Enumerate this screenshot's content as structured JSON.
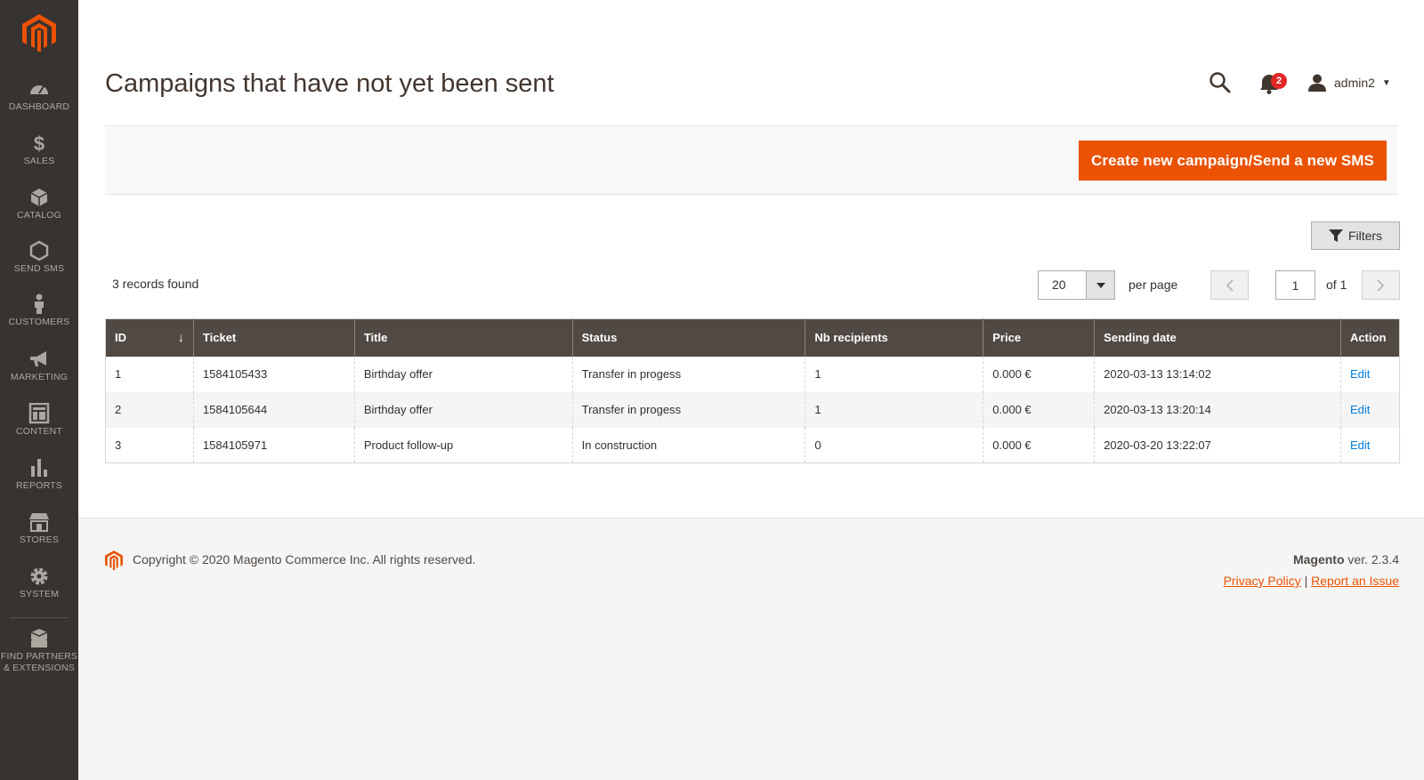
{
  "sidebar": {
    "items": [
      {
        "label": "DASHBOARD",
        "icon": "dashboard-icon"
      },
      {
        "label": "SALES",
        "icon": "dollar-icon"
      },
      {
        "label": "CATALOG",
        "icon": "box-icon"
      },
      {
        "label": "SEND SMS",
        "icon": "hexagon-icon"
      },
      {
        "label": "CUSTOMERS",
        "icon": "person-icon"
      },
      {
        "label": "MARKETING",
        "icon": "megaphone-icon"
      },
      {
        "label": "CONTENT",
        "icon": "layout-icon"
      },
      {
        "label": "REPORTS",
        "icon": "bar-chart-icon"
      },
      {
        "label": "STORES",
        "icon": "store-icon"
      },
      {
        "label": "SYSTEM",
        "icon": "gear-icon"
      },
      {
        "label_line1": "FIND PARTNERS",
        "label_line2": "& EXTENSIONS",
        "icon": "extensions-icon"
      }
    ]
  },
  "header": {
    "title": "Campaigns that have not yet been sent",
    "notifications_count": "2",
    "user_name": "admin2"
  },
  "actions": {
    "create_label": "Create new campaign/Send a new SMS",
    "filters_label": "Filters"
  },
  "grid": {
    "records_found": "3 records found",
    "per_page_value": "20",
    "per_page_label": "per page",
    "current_page": "1",
    "page_of": "of 1",
    "columns": [
      "ID",
      "Ticket",
      "Title",
      "Status",
      "Nb recipients",
      "Price",
      "Sending date",
      "Action"
    ],
    "rows": [
      [
        "1",
        "1584105433",
        "Birthday offer",
        "Transfer in progess",
        "1",
        "0.000 €",
        "2020-03-13 13:14:02",
        "Edit"
      ],
      [
        "2",
        "1584105644",
        "Birthday offer",
        "Transfer in progess",
        "1",
        "0.000 €",
        "2020-03-13 13:20:14",
        "Edit"
      ],
      [
        "3",
        "1584105971",
        "Product follow-up",
        "In construction",
        "0",
        "0.000 €",
        "2020-03-20 13:22:07",
        "Edit"
      ]
    ]
  },
  "footer": {
    "copyright": "Copyright © 2020 Magento Commerce Inc. All rights reserved.",
    "brand": "Magento",
    "version": " ver. 2.3.4",
    "privacy_link": "Privacy Policy",
    "separator": " | ",
    "report_link": "Report an Issue"
  },
  "colors": {
    "accent": "#eb5202",
    "sidebar_bg": "#373330",
    "table_header_bg": "#514943",
    "link": "#007bdb",
    "badge": "#e22626"
  }
}
